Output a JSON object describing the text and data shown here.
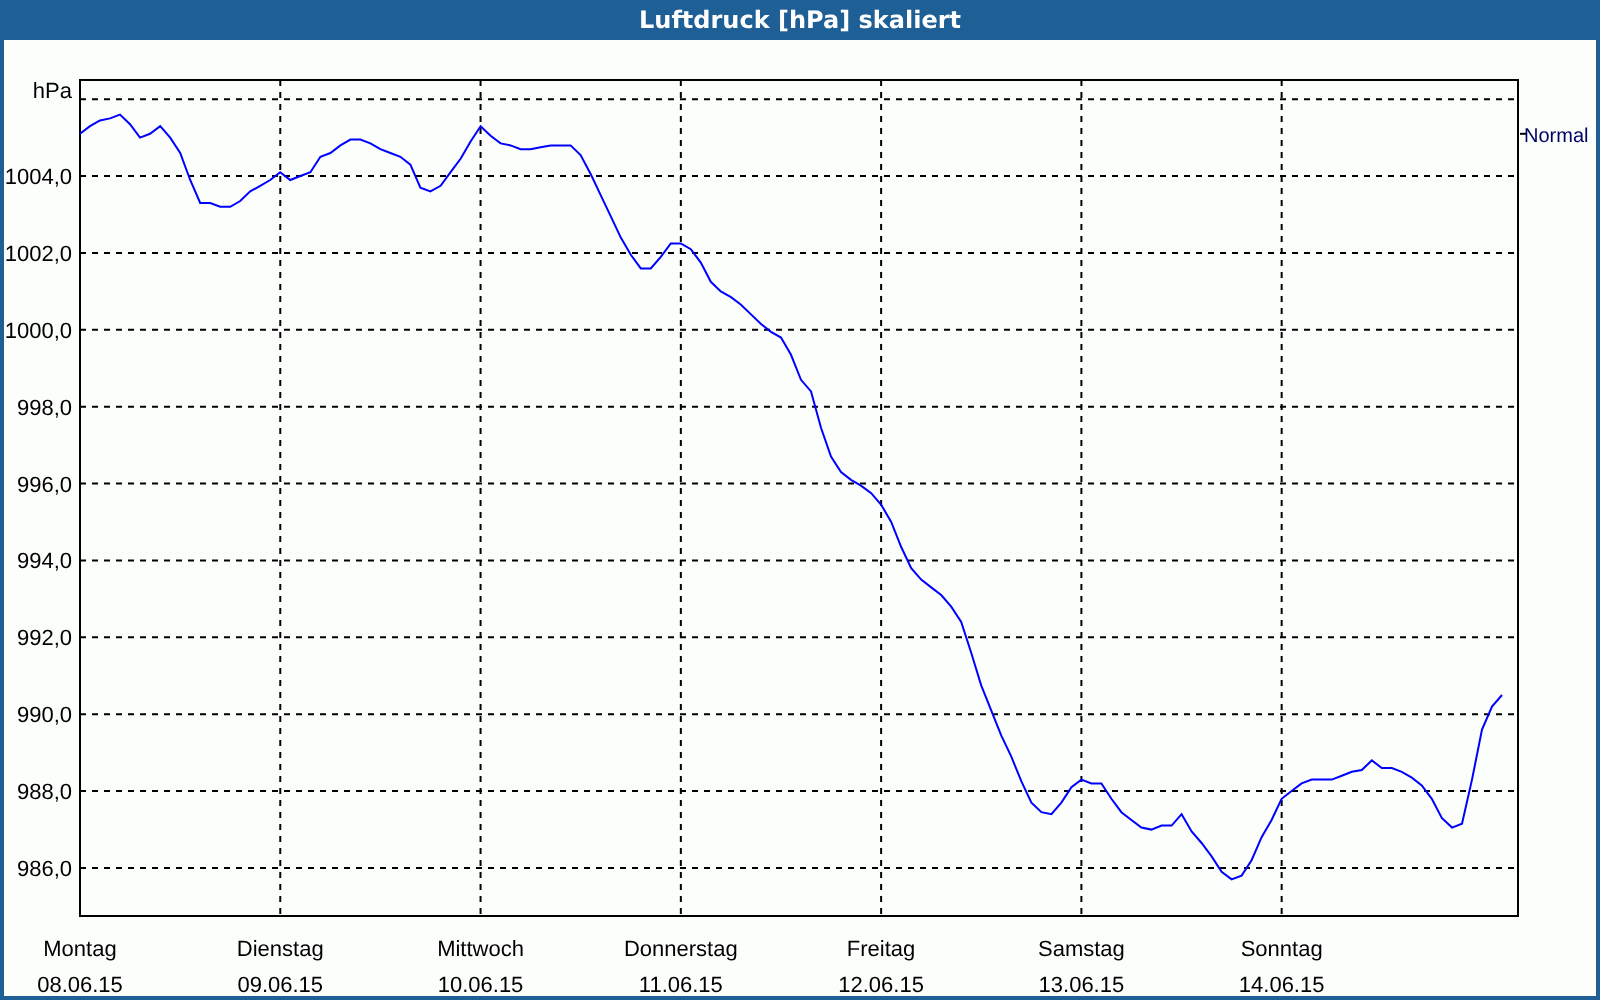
{
  "chart_data": {
    "type": "line",
    "title": "Luftdruck [hPa] skaliert",
    "ylabel": "hPa",
    "grid": true,
    "ylim": [
      984.75,
      1006.5
    ],
    "yticks": [
      {
        "value": 986,
        "label": "986,0"
      },
      {
        "value": 988,
        "label": "988,0"
      },
      {
        "value": 990,
        "label": "990,0"
      },
      {
        "value": 992,
        "label": "992,0"
      },
      {
        "value": 994,
        "label": "994,0"
      },
      {
        "value": 996,
        "label": "996,0"
      },
      {
        "value": 998,
        "label": "998,0"
      },
      {
        "value": 1000,
        "label": "1000,0"
      },
      {
        "value": 1002,
        "label": "1002,0"
      },
      {
        "value": 1004,
        "label": "1004,0"
      }
    ],
    "categories": [
      "Montag\n08.06.15",
      null,
      null,
      null,
      null,
      null,
      null,
      null,
      null,
      null,
      null,
      null,
      null,
      null,
      null,
      null,
      null,
      null,
      null,
      null,
      "Dienstag\n09.06.15",
      null,
      null,
      null,
      null,
      null,
      null,
      null,
      null,
      null,
      null,
      null,
      null,
      null,
      null,
      null,
      null,
      null,
      null,
      null,
      "Mittwoch\n10.06.15",
      null,
      null,
      null,
      null,
      null,
      null,
      null,
      null,
      null,
      null,
      null,
      null,
      null,
      null,
      null,
      null,
      null,
      null,
      null,
      "Donnerstag\n11.06.15",
      null,
      null,
      null,
      null,
      null,
      null,
      null,
      null,
      null,
      null,
      null,
      null,
      null,
      null,
      null,
      null,
      null,
      null,
      null,
      "Freitag\n12.06.15",
      null,
      null,
      null,
      null,
      null,
      null,
      null,
      null,
      null,
      null,
      null,
      null,
      null,
      null,
      null,
      null,
      null,
      null,
      null,
      "Samstag\n13.06.15",
      null,
      null,
      null,
      null,
      null,
      null,
      null,
      null,
      null,
      null,
      null,
      null,
      null,
      null,
      null,
      null,
      null,
      null,
      null,
      "Sonntag\n14.06.15",
      null,
      null,
      null,
      null,
      null,
      null,
      null,
      null,
      null,
      null,
      null,
      null,
      null,
      null,
      null,
      null,
      null,
      null,
      null,
      null,
      null,
      null
    ],
    "series": [
      {
        "name": "Normal",
        "color": "#0000ff",
        "values": [
          1005.1,
          1005.3,
          1005.45,
          1005.5,
          1005.6,
          1005.35,
          1005.0,
          1005.1,
          1005.3,
          1005.0,
          1004.6,
          1003.9,
          1003.3,
          1003.3,
          1003.2,
          1003.2,
          1003.35,
          1003.6,
          1003.75,
          1003.9,
          1004.1,
          1003.9,
          1004.0,
          1004.1,
          1004.5,
          1004.6,
          1004.8,
          1004.95,
          1004.95,
          1004.85,
          1004.7,
          1004.6,
          1004.5,
          1004.3,
          1003.7,
          1003.6,
          1003.75,
          1004.1,
          1004.45,
          1004.9,
          1005.3,
          1005.05,
          1004.85,
          1004.8,
          1004.7,
          1004.7,
          1004.75,
          1004.8,
          1004.8,
          1004.8,
          1004.55,
          1004.05,
          1003.5,
          1002.95,
          1002.4,
          1001.95,
          1001.6,
          1001.6,
          1001.9,
          1002.25,
          1002.25,
          1002.1,
          1001.75,
          1001.25,
          1001.0,
          1000.85,
          1000.65,
          1000.4,
          1000.15,
          999.95,
          999.8,
          999.35,
          998.7,
          998.4,
          997.45,
          996.7,
          996.3,
          996.1,
          995.95,
          995.75,
          995.45,
          995.0,
          994.35,
          993.8,
          993.5,
          993.3,
          993.1,
          992.8,
          992.4,
          991.6,
          990.75,
          990.1,
          989.45,
          988.9,
          988.25,
          987.7,
          987.45,
          987.4,
          987.7,
          988.1,
          988.3,
          988.2,
          988.2,
          987.8,
          987.45,
          987.25,
          987.05,
          987.0,
          987.1,
          987.1,
          987.4,
          986.95,
          986.65,
          986.3,
          985.9,
          985.7,
          985.8,
          986.2,
          986.8,
          987.25,
          987.8,
          988.0,
          988.2,
          988.3,
          988.3,
          988.3,
          988.4,
          988.5,
          988.55,
          988.8,
          988.6,
          988.6,
          988.5,
          988.35,
          988.15,
          987.8,
          987.3,
          987.05,
          987.15,
          988.3,
          989.6,
          990.2,
          990.5
        ]
      }
    ]
  }
}
